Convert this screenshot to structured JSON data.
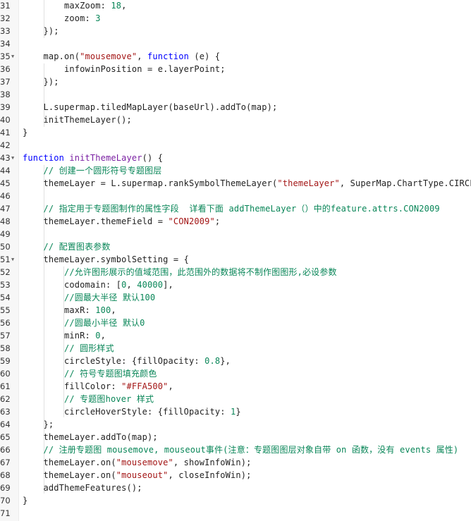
{
  "editor": {
    "language": "javascript",
    "lines": [
      {
        "n": "31",
        "fold": false,
        "tokens": [
          [
            "p",
            "        maxZoom: "
          ],
          [
            "num",
            "18"
          ],
          [
            "p",
            ","
          ]
        ]
      },
      {
        "n": "32",
        "fold": false,
        "tokens": [
          [
            "p",
            "        zoom: "
          ],
          [
            "num",
            "3"
          ]
        ]
      },
      {
        "n": "33",
        "fold": false,
        "tokens": [
          [
            "p",
            "    });"
          ]
        ]
      },
      {
        "n": "34",
        "fold": false,
        "tokens": []
      },
      {
        "n": "35",
        "fold": true,
        "tokens": [
          [
            "p",
            "    map.on("
          ],
          [
            "str",
            "\"mousemove\""
          ],
          [
            "p",
            ", "
          ],
          [
            "kw",
            "function"
          ],
          [
            "p",
            " (e) {"
          ]
        ]
      },
      {
        "n": "36",
        "fold": false,
        "tokens": [
          [
            "p",
            "        infowinPosition = e.layerPoint;"
          ]
        ]
      },
      {
        "n": "37",
        "fold": false,
        "tokens": [
          [
            "p",
            "    });"
          ]
        ]
      },
      {
        "n": "38",
        "fold": false,
        "tokens": []
      },
      {
        "n": "39",
        "fold": false,
        "tokens": [
          [
            "p",
            "    L.supermap.tiledMapLayer(baseUrl).addTo(map);"
          ]
        ]
      },
      {
        "n": "40",
        "fold": false,
        "tokens": [
          [
            "p",
            "    initThemeLayer();"
          ]
        ]
      },
      {
        "n": "41",
        "fold": false,
        "tokens": [
          [
            "p",
            "}"
          ]
        ]
      },
      {
        "n": "42",
        "fold": false,
        "tokens": []
      },
      {
        "n": "43",
        "fold": true,
        "tokens": [
          [
            "kw",
            "function"
          ],
          [
            "p",
            " "
          ],
          [
            "fn",
            "initThemeLayer"
          ],
          [
            "p",
            "() {"
          ]
        ]
      },
      {
        "n": "44",
        "fold": false,
        "tokens": [
          [
            "p",
            "    "
          ],
          [
            "cm",
            "// 创建一个圆形符号专题图层"
          ]
        ]
      },
      {
        "n": "45",
        "fold": false,
        "tokens": [
          [
            "p",
            "    themeLayer = L.supermap.rankSymbolThemeLayer("
          ],
          [
            "str",
            "\"themeLayer\""
          ],
          [
            "p",
            ", SuperMap.ChartType.CIRCLE);"
          ]
        ]
      },
      {
        "n": "46",
        "fold": false,
        "tokens": []
      },
      {
        "n": "47",
        "fold": false,
        "tokens": [
          [
            "p",
            "    "
          ],
          [
            "cm",
            "// 指定用于专题图制作的属性字段  详看下面 addThemeLayer（）中的feature.attrs.CON2009"
          ]
        ]
      },
      {
        "n": "48",
        "fold": false,
        "tokens": [
          [
            "p",
            "    themeLayer.themeField = "
          ],
          [
            "str",
            "\"CON2009\""
          ],
          [
            "p",
            ";"
          ]
        ]
      },
      {
        "n": "49",
        "fold": false,
        "tokens": []
      },
      {
        "n": "50",
        "fold": false,
        "tokens": [
          [
            "p",
            "    "
          ],
          [
            "cm",
            "// 配置图表参数"
          ]
        ]
      },
      {
        "n": "51",
        "fold": true,
        "tokens": [
          [
            "p",
            "    themeLayer.symbolSetting = {"
          ]
        ]
      },
      {
        "n": "52",
        "fold": false,
        "tokens": [
          [
            "p",
            "        "
          ],
          [
            "cm",
            "//允许图形展示的值域范围，此范围外的数据将不制作图图形,必设参数"
          ]
        ]
      },
      {
        "n": "53",
        "fold": false,
        "tokens": [
          [
            "p",
            "        codomain: ["
          ],
          [
            "num",
            "0"
          ],
          [
            "p",
            ", "
          ],
          [
            "num",
            "40000"
          ],
          [
            "p",
            "],"
          ]
        ]
      },
      {
        "n": "54",
        "fold": false,
        "tokens": [
          [
            "p",
            "        "
          ],
          [
            "cm",
            "//圆最大半径 默认100"
          ]
        ]
      },
      {
        "n": "55",
        "fold": false,
        "tokens": [
          [
            "p",
            "        maxR: "
          ],
          [
            "num",
            "100"
          ],
          [
            "p",
            ","
          ]
        ]
      },
      {
        "n": "56",
        "fold": false,
        "tokens": [
          [
            "p",
            "        "
          ],
          [
            "cm",
            "//圆最小半径 默认0"
          ]
        ]
      },
      {
        "n": "57",
        "fold": false,
        "tokens": [
          [
            "p",
            "        minR: "
          ],
          [
            "num",
            "0"
          ],
          [
            "p",
            ","
          ]
        ]
      },
      {
        "n": "58",
        "fold": false,
        "tokens": [
          [
            "p",
            "        "
          ],
          [
            "cm",
            "// 圆形样式"
          ]
        ]
      },
      {
        "n": "59",
        "fold": false,
        "tokens": [
          [
            "p",
            "        circleStyle: {fillOpacity: "
          ],
          [
            "num",
            "0.8"
          ],
          [
            "p",
            "},"
          ]
        ]
      },
      {
        "n": "60",
        "fold": false,
        "tokens": [
          [
            "p",
            "        "
          ],
          [
            "cm",
            "// 符号专题图填充颜色"
          ]
        ]
      },
      {
        "n": "61",
        "fold": false,
        "tokens": [
          [
            "p",
            "        fillColor: "
          ],
          [
            "str",
            "\"#FFA500\""
          ],
          [
            "p",
            ","
          ]
        ]
      },
      {
        "n": "62",
        "fold": false,
        "tokens": [
          [
            "p",
            "        "
          ],
          [
            "cm",
            "// 专题图hover 样式"
          ]
        ]
      },
      {
        "n": "63",
        "fold": false,
        "tokens": [
          [
            "p",
            "        circleHoverStyle: {fillOpacity: "
          ],
          [
            "num",
            "1"
          ],
          [
            "p",
            "}"
          ]
        ]
      },
      {
        "n": "64",
        "fold": false,
        "tokens": [
          [
            "p",
            "    };"
          ]
        ]
      },
      {
        "n": "65",
        "fold": false,
        "tokens": [
          [
            "p",
            "    themeLayer.addTo(map);"
          ]
        ]
      },
      {
        "n": "66",
        "fold": false,
        "tokens": [
          [
            "p",
            "    "
          ],
          [
            "cm",
            "// 注册专题图 mousemove, mouseout事件(注意：专题图图层对象自带 on 函数，没有 events 属性)"
          ]
        ]
      },
      {
        "n": "67",
        "fold": false,
        "tokens": [
          [
            "p",
            "    themeLayer.on("
          ],
          [
            "str",
            "\"mousemove\""
          ],
          [
            "p",
            ", showInfoWin);"
          ]
        ]
      },
      {
        "n": "68",
        "fold": false,
        "tokens": [
          [
            "p",
            "    themeLayer.on("
          ],
          [
            "str",
            "\"mouseout\""
          ],
          [
            "p",
            ", closeInfoWin);"
          ]
        ]
      },
      {
        "n": "69",
        "fold": false,
        "tokens": [
          [
            "p",
            "    addThemeFeatures();"
          ]
        ]
      },
      {
        "n": "70",
        "fold": false,
        "tokens": [
          [
            "p",
            "}"
          ]
        ]
      },
      {
        "n": "71",
        "fold": false,
        "tokens": []
      }
    ],
    "colors": {
      "keyword": "#0000ff",
      "function": "#7a1fa2",
      "string": "#a31515",
      "number": "#098658",
      "comment": "#098658",
      "plain": "#222222",
      "gutter_bg": "#f7f7f7"
    },
    "icons": {
      "fold": "fold-arrow-icon"
    }
  }
}
